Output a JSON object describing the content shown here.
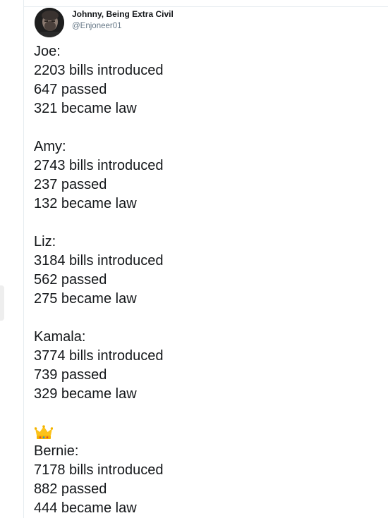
{
  "tweet": {
    "author": {
      "display_name": "Johnny, Being Extra Civil",
      "handle": "@Enjoneer01"
    },
    "blocks": [
      {
        "name": "Joe:",
        "introduced": "2203 bills introduced",
        "passed": "647 passed",
        "law": "321 became law"
      },
      {
        "name": "Amy:",
        "introduced": "2743 bills introduced",
        "passed": "237 passed",
        "law": "132 became law"
      },
      {
        "name": "Liz:",
        "introduced": "3184 bills introduced",
        "passed": "562 passed",
        "law": "275 became law"
      },
      {
        "name": "Kamala:",
        "introduced": "3774 bills introduced",
        "passed": "739 passed",
        "law": "329 became law"
      },
      {
        "emoji": "crown-icon",
        "name": "Bernie:",
        "introduced": "7178 bills introduced",
        "passed": "882 passed",
        "law": "444 became law"
      }
    ]
  },
  "colors": {
    "text": "#14171a",
    "secondary_text": "#657786",
    "border": "#e6ecf0",
    "crown_gold": "#f4b400"
  }
}
